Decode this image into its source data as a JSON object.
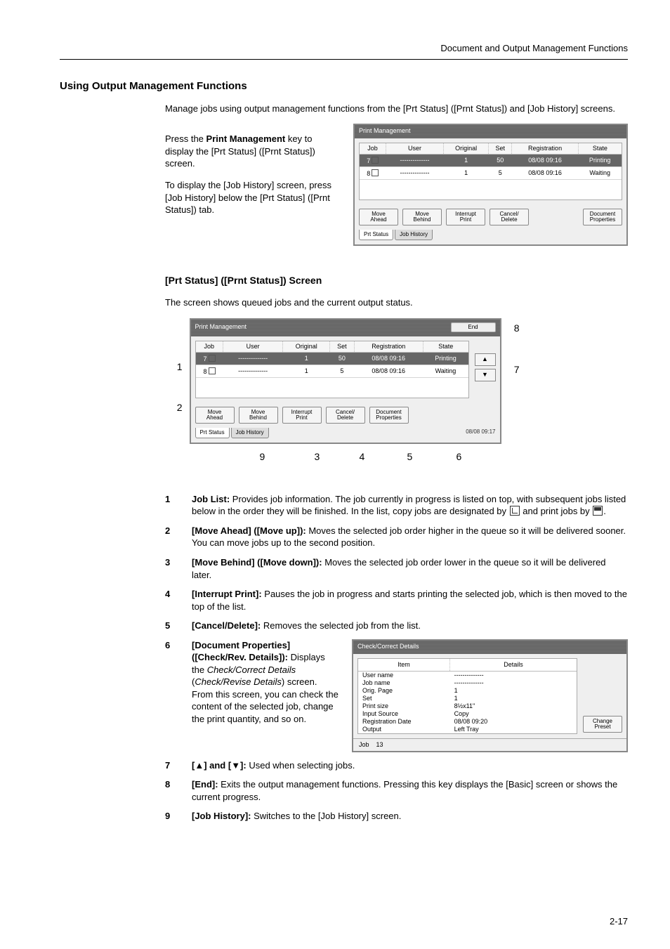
{
  "running_header": "Document and Output Management Functions",
  "h1": "Using Output Management Functions",
  "intro": "Manage jobs using output management functions from the [Prt Status] ([Prnt Status]) and [Job History] screens.",
  "para1_a": "Press the ",
  "para1_b": "Print Management",
  "para1_c": " key to display the [Prt Status] ([Prnt Status]) screen.",
  "para2": "To display the [Job History] screen, press [Job History] below the [Prt Status] ([Prnt Status]) tab.",
  "device": {
    "title": "Print Management",
    "end_btn": "End",
    "cols": {
      "job": "Job",
      "user": "User",
      "original": "Original",
      "set": "Set",
      "registration": "Registration",
      "state": "State"
    },
    "rows": [
      {
        "job": "7",
        "user": "--------------",
        "original": "1",
        "set": "50",
        "registration": "08/08 09:16",
        "state": "Printing"
      },
      {
        "job": "8",
        "user": "--------------",
        "original": "1",
        "set": "5",
        "registration": "08/08 09:16",
        "state": "Waiting"
      }
    ],
    "btns": {
      "move_ahead": "Move\nAhead",
      "move_behind": "Move\nBehind",
      "interrupt": "Interrupt\nPrint",
      "cancel": "Cancel/\nDelete",
      "docprops": "Document\nProperties"
    },
    "tabs": {
      "prt": "Prt Status",
      "hist": "Job History"
    },
    "timestamp": "08/08 09:17"
  },
  "h2": "[Prt Status] ([Prnt Status]) Screen",
  "h2_sub": "The screen shows queued jobs and the current output status.",
  "callouts": {
    "1": "1",
    "2": "2",
    "3": "3",
    "4": "4",
    "5": "5",
    "6": "6",
    "7": "7",
    "8": "8",
    "9": "9"
  },
  "items": {
    "1": {
      "title": "Job List:",
      "body_a": " Provides job information. The job currently in progress is listed on top, with subsequent jobs listed below in the order they will be finished. In the list, copy jobs are designated by ",
      "body_b": " and print jobs by ",
      "body_c": "."
    },
    "2": {
      "title": "[Move Ahead] ([Move up]):",
      "body": " Moves the selected job order higher in the queue so it will be delivered sooner. You can move jobs up to the second position."
    },
    "3": {
      "title": "[Move Behind] ([Move down]):",
      "body": " Moves the selected job order lower in the queue so it will be delivered later."
    },
    "4": {
      "title": "[Interrupt Print]:",
      "body": " Pauses the job in progress and starts printing the selected job, which is then moved to the top of the list."
    },
    "5": {
      "title": "[Cancel/Delete]:",
      "body": " Removes the selected job from the list."
    },
    "6": {
      "title": "[Document Properties] ([Check/Rev. Details]):",
      "body_a": " Displays the ",
      "body_b": "Check/Correct Details",
      "body_c": " (",
      "body_d": "Check/Revise Details",
      "body_e": ") screen. From this screen, you can check the content of the selected job, change the print quantity, and so on."
    },
    "7": {
      "title": "[▲] and [▼]:",
      "body": " Used when selecting jobs."
    },
    "8": {
      "title": "[End]:",
      "body": " Exits the output management functions. Pressing this key displays the [Basic] screen or shows the current progress."
    },
    "9": {
      "title": "[Job History]:",
      "body": " Switches to the [Job History] screen."
    }
  },
  "details": {
    "title": "Check/Correct Details",
    "col_item": "Item",
    "col_details": "Details",
    "rows": [
      {
        "k": "User name",
        "v": "--------------"
      },
      {
        "k": "Job name",
        "v": "--------------"
      },
      {
        "k": "Orig. Page",
        "v": "1"
      },
      {
        "k": "Set",
        "v": "1"
      },
      {
        "k": "Print size",
        "v": "8½x11\""
      },
      {
        "k": "Input Source",
        "v": "Copy"
      },
      {
        "k": "Registration Date",
        "v": "08/08 09:20"
      },
      {
        "k": "Output",
        "v": "Left Tray"
      }
    ],
    "change_btn": "Change\nPreset",
    "job_label": "Job",
    "job_value": "13"
  },
  "page_number": "2-17"
}
